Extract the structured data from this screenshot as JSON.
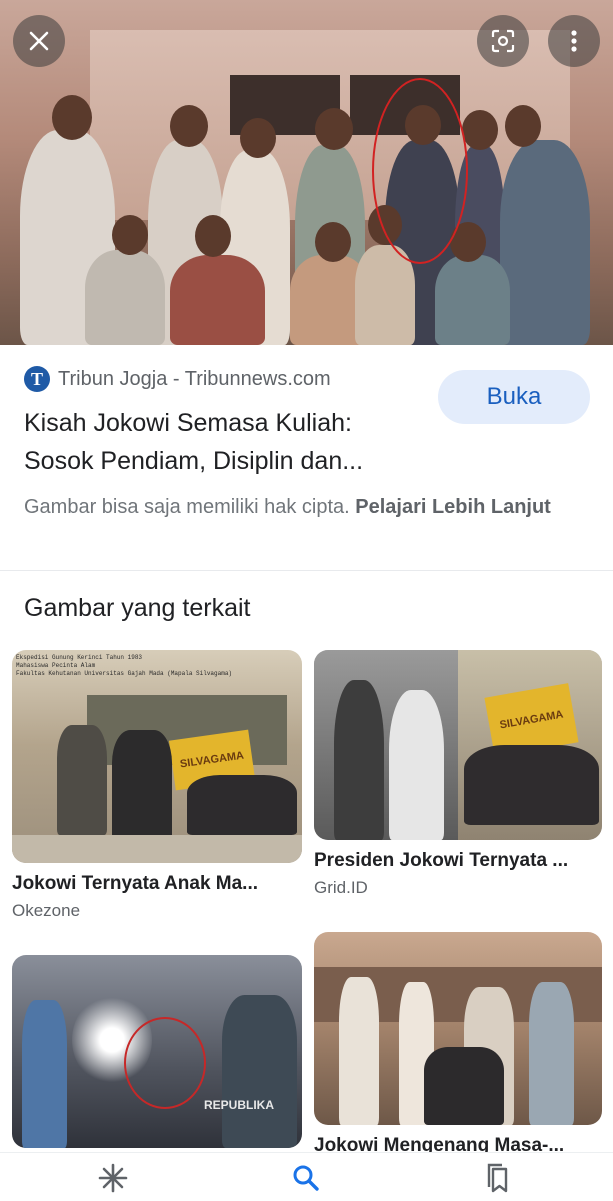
{
  "hero": {
    "close_icon": "close-icon",
    "lens_icon": "google-lens-icon",
    "more_icon": "more-vert-icon"
  },
  "source": {
    "logo_letter": "T",
    "name": "Tribun Jogja - Tribunnews.com",
    "open_button": "Buka"
  },
  "title": {
    "line1": "Kisah Jokowi Semasa Kuliah:",
    "line2": "Sosok Pendiam, Disiplin dan..."
  },
  "copyright": {
    "text": "Gambar bisa saja memiliki hak cipta.",
    "link": "Pelajari Lebih Lanjut"
  },
  "related": {
    "heading": "Gambar yang terkait",
    "items": [
      {
        "caption": "Jokowi Ternyata Anak Ma...",
        "source": "Okezone",
        "overlay_text": "Ekspedisi Gunung Kerinci Tahun 1983\nMahasiswa Pecinta Alam\nFakultas Kehutanan Universitas Gajah Mada (Mapala Silvagama)",
        "banner": "SILVAGAMA"
      },
      {
        "caption": "Presiden Jokowi Ternyata ...",
        "source": "Grid.ID",
        "banner": "SILVAGAMA"
      },
      {
        "caption": "",
        "source": "",
        "watermark": "REPUBLIKA"
      },
      {
        "caption": "Jokowi Mengenang Masa-...",
        "source": ""
      }
    ]
  },
  "nav": {
    "discover_icon": "discover-asterisk-icon",
    "search_icon": "search-icon",
    "collections_icon": "collections-bookmark-icon",
    "active_color": "#1a73e8"
  }
}
